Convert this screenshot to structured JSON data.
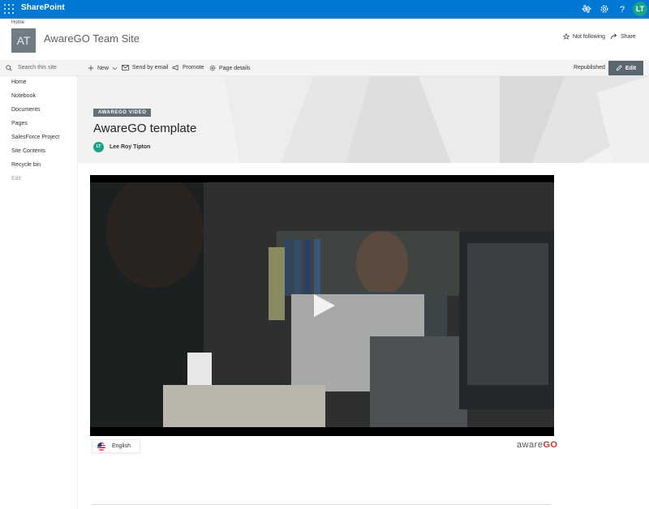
{
  "suite": {
    "app_name": "SharePoint",
    "user_initials": "LT"
  },
  "site": {
    "breadcrumb": "Home",
    "logo_text": "AT",
    "title": "AwareGO Team Site",
    "not_following": "Not following",
    "share": "Share"
  },
  "search": {
    "placeholder": "Search this site"
  },
  "nav": {
    "items": [
      "Home",
      "Notebook",
      "Documents",
      "Pages",
      "SalesForce Project",
      "Site Contents",
      "Recycle bin"
    ],
    "edit": "Edit"
  },
  "commandbar": {
    "new": "New",
    "send_by_email": "Send by email",
    "promote": "Promote",
    "page_details": "Page details",
    "status": "Republished",
    "edit": "Edit"
  },
  "hero": {
    "badge": "AWAREGO VIDEO",
    "title": "AwareGO template",
    "author_initials": "LT",
    "author_name": "Lee Roy Tipton"
  },
  "video": {
    "language": "English",
    "brand_prefix": "aware",
    "brand_suffix": "GO"
  },
  "colors": {
    "suite_blue": "#0078d4",
    "accent_teal": "#17a589",
    "edit_button": "#5a6770"
  },
  "icons": {
    "app_launcher": "waffle-icon",
    "sync": "sync-icon",
    "settings": "gear-icon",
    "help": "help-icon",
    "follow": "star-icon",
    "share": "share-icon",
    "search": "search-icon",
    "new": "plus-icon",
    "email": "email-icon",
    "promote": "megaphone-icon",
    "page_details": "gear-icon",
    "edit": "pencil-icon",
    "play": "play-icon",
    "flag": "us-flag-icon"
  }
}
